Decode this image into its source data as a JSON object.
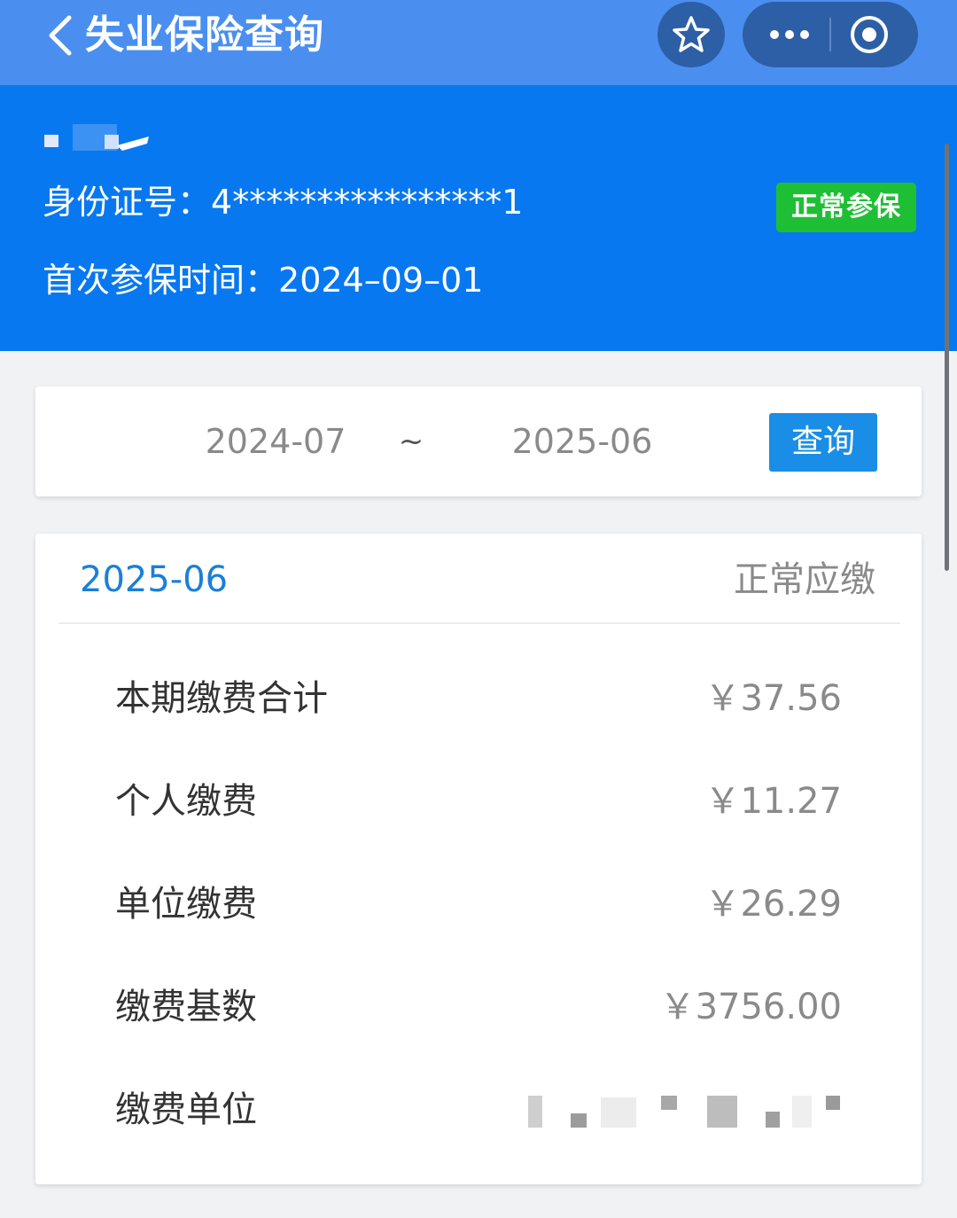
{
  "topbar": {
    "title": "失业保险查询",
    "back_icon": "chevron-left-icon",
    "star_icon": "star-icon",
    "more_icon": "more-dots-icon",
    "close_icon": "target-circle-icon"
  },
  "profile": {
    "id_label": "身份证号：",
    "id_value": "4****************1",
    "first_insured_label": "首次参保时间：",
    "first_insured_value": "2024–09–01",
    "status_badge": "正常参保"
  },
  "search": {
    "from": "2024-07",
    "separator": "~",
    "to": "2025-06",
    "query_button": "查询"
  },
  "detail": {
    "period": "2025-06",
    "status": "正常应缴",
    "rows": [
      {
        "label": "本期缴费合计",
        "value": "￥37.56"
      },
      {
        "label": "个人缴费",
        "value": "￥11.27"
      },
      {
        "label": "单位缴费",
        "value": "￥26.29"
      },
      {
        "label": "缴费基数",
        "value": "￥3756.00"
      },
      {
        "label": "缴费单位",
        "value": ""
      }
    ]
  },
  "colors": {
    "topbar": "#4a8ff0",
    "header": "#0878f0",
    "badge": "#1fbf35",
    "button": "#1a8de6",
    "period_text": "#1a7fd8"
  }
}
